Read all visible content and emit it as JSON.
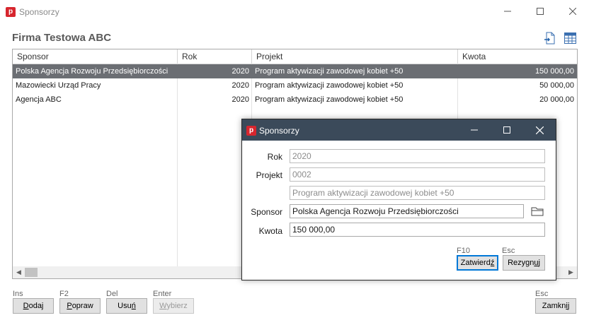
{
  "window": {
    "title": "Sponsorzy",
    "app_icon_glyph": "p",
    "heading": "Firma Testowa ABC"
  },
  "grid": {
    "columns": [
      "Sponsor",
      "Rok",
      "Projekt",
      "Kwota"
    ],
    "rows": [
      {
        "sponsor": "Polska Agencja Rozwoju Przedsiębiorczości",
        "rok": "2020",
        "projekt": "Program aktywizacji zawodowej kobiet +50",
        "kwota": "150 000,00",
        "selected": true
      },
      {
        "sponsor": "Mazowiecki Urząd Pracy",
        "rok": "2020",
        "projekt": "Program aktywizacji zawodowej kobiet +50",
        "kwota": "50 000,00",
        "selected": false
      },
      {
        "sponsor": "Agencja ABC",
        "rok": "2020",
        "projekt": "Program aktywizacji zawodowej kobiet +50",
        "kwota": "20 000,00",
        "selected": false
      }
    ]
  },
  "toolbar": {
    "export_icon": "export-document-icon",
    "table_icon": "table-grid-icon"
  },
  "buttons": {
    "add": {
      "key": "Ins",
      "label_u": "D",
      "label_rest": "odaj"
    },
    "edit": {
      "key": "F2",
      "label_u": "P",
      "label_rest": "opraw"
    },
    "delete": {
      "key": "Del",
      "label_pre": "Usu",
      "label_u": "ń"
    },
    "select": {
      "key": "Enter",
      "label_u": "W",
      "label_rest": "ybierz"
    },
    "close": {
      "key": "Esc",
      "label_pre": "Zamkn",
      "label_u": "i",
      "label_rest": "j"
    }
  },
  "dialog": {
    "title": "Sponsorzy",
    "app_icon_glyph": "p",
    "labels": {
      "rok": "Rok",
      "projekt": "Projekt",
      "sponsor": "Sponsor",
      "kwota": "Kwota"
    },
    "values": {
      "rok": "2020",
      "projekt_code": "0002",
      "projekt_name": "Program aktywizacji zawodowej kobiet +50",
      "sponsor": "Polska Agencja Rozwoju Przedsiębiorczości",
      "kwota": "150 000,00"
    },
    "confirm": {
      "key": "F10",
      "label_pre": "Zatwierd",
      "label_u": "ź"
    },
    "cancel": {
      "key": "Esc",
      "label_pre": "Rezygn",
      "label_u": "u",
      "label_rest": "j"
    }
  },
  "colors": {
    "accent": "#0078d7",
    "selected_row": "#6b6e73",
    "dialog_titlebar": "#3b4a5a",
    "app_icon": "#d7262e"
  }
}
